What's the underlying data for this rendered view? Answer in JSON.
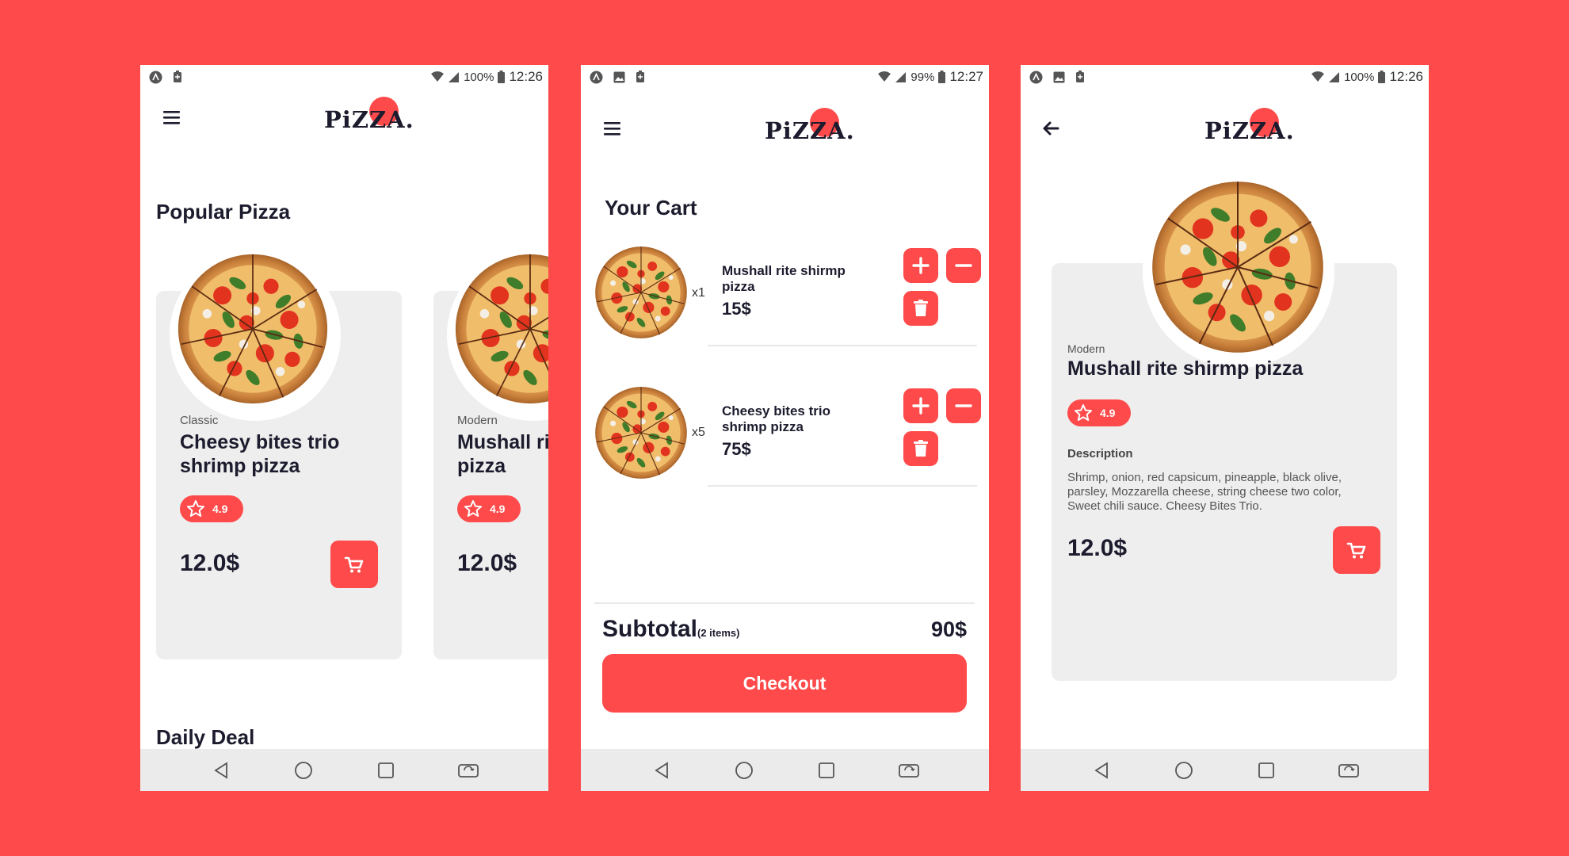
{
  "colors": {
    "accent": "#fe4a4a",
    "card": "#eeeeee",
    "text": "#1c1c2e",
    "nav": "#ebebeb"
  },
  "brand": {
    "logo_text": "PiZZA."
  },
  "screens": {
    "home": {
      "status": {
        "battery": "100%",
        "time": "12:26"
      },
      "section_title": "Popular Pizza",
      "cards": [
        {
          "category": "Classic",
          "name": "Cheesy bites trio shrimp pizza",
          "rating": "4.9",
          "price": "12.0$"
        },
        {
          "category": "Modern",
          "name": "Mushall rite shirmp pizza",
          "rating": "4.9",
          "price": "12.0$"
        }
      ],
      "section_title_2": "Daily Deal"
    },
    "cart": {
      "status": {
        "battery": "99%",
        "time": "12:27"
      },
      "title": "Your Cart",
      "items": [
        {
          "qty": "x1",
          "name": "Mushall rite shirmp pizza",
          "price": "15$"
        },
        {
          "qty": "x5",
          "name": "Cheesy bites trio shrimp pizza",
          "price": "75$"
        }
      ],
      "subtotal_label": "Subtotal",
      "subtotal_count": "(2 items)",
      "subtotal_value": "90$",
      "checkout_label": "Checkout"
    },
    "detail": {
      "status": {
        "battery": "100%",
        "time": "12:26"
      },
      "category": "Modern",
      "name": "Mushall rite shirmp pizza",
      "rating": "4.9",
      "description_label": "Description",
      "description": "Shrimp, onion, red capsicum, pineapple, black olive, parsley, Mozzarella cheese, string cheese two color, Sweet chili sauce. Cheesy Bites Trio.",
      "price": "12.0$"
    }
  },
  "icons": {
    "status_left": [
      "app-notification-icon",
      "image-icon",
      "battery-saver-icon"
    ],
    "status_right": [
      "wifi-icon",
      "signal-icon",
      "battery-icon"
    ],
    "nav": [
      "back-triangle-icon",
      "home-circle-icon",
      "recents-square-icon",
      "rotate-screen-icon"
    ]
  }
}
